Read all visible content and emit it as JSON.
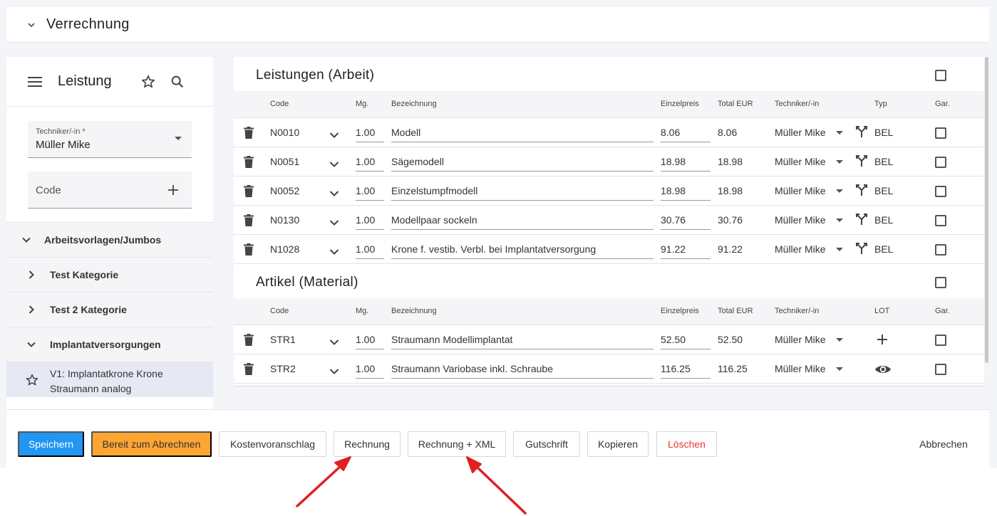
{
  "header": {
    "title": "Verrechnung"
  },
  "left": {
    "title": "Leistung",
    "technician": {
      "label": "Techniker/-in *",
      "value": "Müller Mike"
    },
    "code": {
      "label": "Code"
    },
    "tree": [
      {
        "label": "Arbeitsvorlagen/Jumbos",
        "expanded": true
      },
      {
        "label": "Test Kategorie",
        "expanded": false
      },
      {
        "label": "Test 2 Kategorie",
        "expanded": false
      },
      {
        "label": "Implantatversorgungen",
        "expanded": true
      }
    ],
    "template": {
      "line1": "V1: Implantatkrone Krone",
      "line2": "Straumann analog"
    }
  },
  "labor": {
    "title": "Leistungen (Arbeit)",
    "columns": {
      "code": "Code",
      "qty": "Mg.",
      "desc": "Bezeichnung",
      "price": "Einzelpreis",
      "total": "Total EUR",
      "tech": "Techniker/-in",
      "type": "Typ",
      "gar": "Gar."
    },
    "rows": [
      {
        "code": "N0010",
        "qty": "1.00",
        "desc": "Modell",
        "price": "8.06",
        "total": "8.06",
        "tech": "Müller Mike",
        "type": "BEL"
      },
      {
        "code": "N0051",
        "qty": "1.00",
        "desc": "Sägemodell",
        "price": "18.98",
        "total": "18.98",
        "tech": "Müller Mike",
        "type": "BEL"
      },
      {
        "code": "N0052",
        "qty": "1.00",
        "desc": "Einzelstumpfmodell",
        "price": "18.98",
        "total": "18.98",
        "tech": "Müller Mike",
        "type": "BEL"
      },
      {
        "code": "N0130",
        "qty": "1.00",
        "desc": "Modellpaar sockeln",
        "price": "30.76",
        "total": "30.76",
        "tech": "Müller Mike",
        "type": "BEL"
      },
      {
        "code": "N1028",
        "qty": "1.00",
        "desc": "Krone f. vestib. Verbl. bei Implantatversorgung",
        "price": "91.22",
        "total": "91.22",
        "tech": "Müller Mike",
        "type": "BEL"
      }
    ]
  },
  "material": {
    "title": "Artikel (Material)",
    "columns": {
      "code": "Code",
      "qty": "Mg.",
      "desc": "Bezeichnung",
      "price": "Einzelpreis",
      "total": "Total EUR",
      "tech": "Techniker/-in",
      "lot": "LOT",
      "gar": "Gar."
    },
    "rows": [
      {
        "code": "STR1",
        "qty": "1.00",
        "desc": "Straumann Modellimplantat",
        "price": "52.50",
        "total": "52.50",
        "tech": "Müller Mike",
        "lot_icon": "plus-icon"
      },
      {
        "code": "STR2",
        "qty": "1.00",
        "desc": "Straumann Variobase inkl. Schraube",
        "price": "116.25",
        "total": "116.25",
        "tech": "Müller Mike",
        "lot_icon": "eye-icon"
      }
    ]
  },
  "footer": {
    "save": "Speichern",
    "ready": "Bereit zum Abrechnen",
    "estimate": "Kostenvoranschlag",
    "invoice": "Rechnung",
    "invoice_xml": "Rechnung + XML",
    "credit": "Gutschrift",
    "copy": "Kopieren",
    "delete": "Löschen",
    "cancel": "Abbrechen"
  },
  "colors": {
    "primary": "#2196f3",
    "warning": "#ffa533",
    "danger": "#e53935",
    "annotation": "#e02020"
  }
}
